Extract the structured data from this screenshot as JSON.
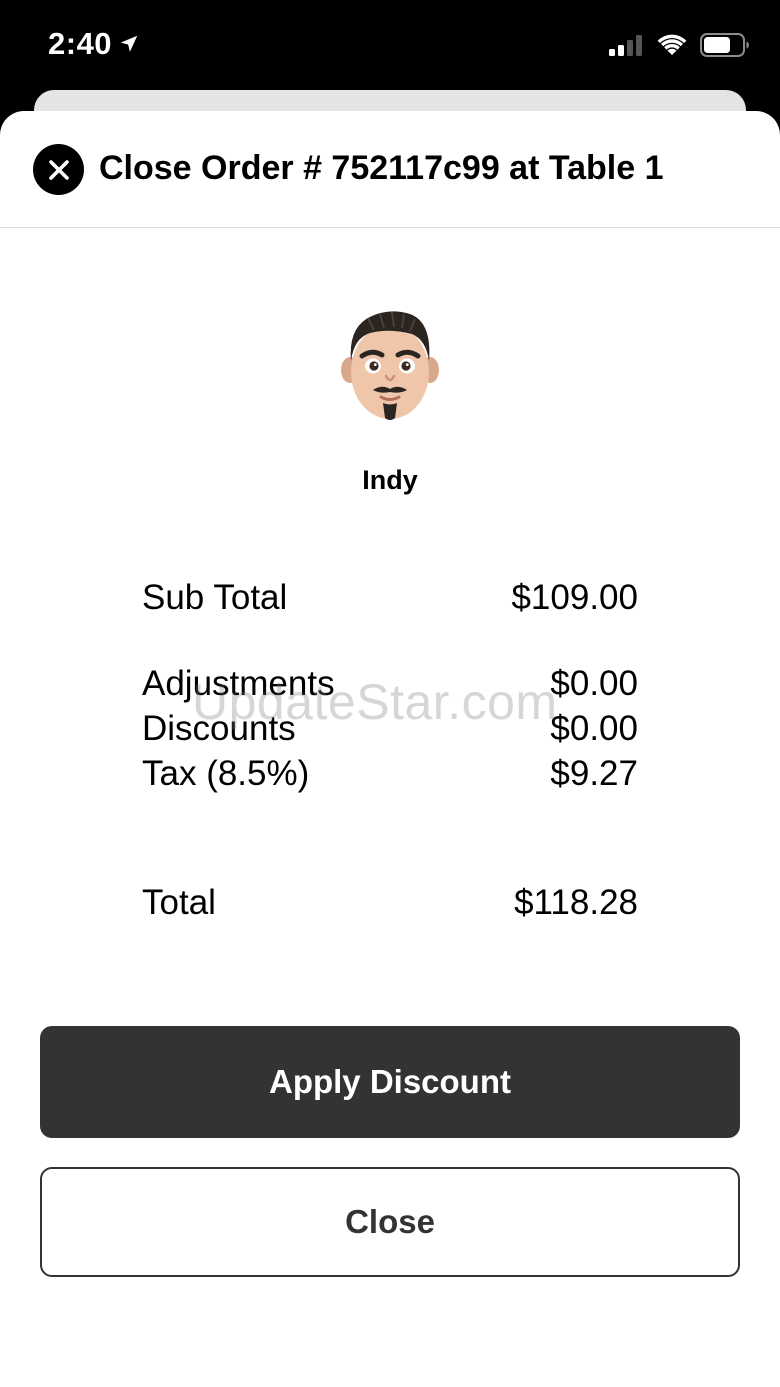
{
  "status_bar": {
    "time": "2:40",
    "location_icon": "location-arrow-icon",
    "signal_icon": "cellular-signal-icon",
    "wifi_icon": "wifi-icon",
    "battery_icon": "battery-icon"
  },
  "header": {
    "close_icon": "close-icon",
    "title": "Close Order # 752117c99 at Table 1"
  },
  "customer": {
    "avatar_icon": "memoji-avatar",
    "name": "Indy"
  },
  "summary": {
    "subtotal_label": "Sub Total",
    "subtotal_value": "$109.00",
    "adjustments_label": "Adjustments",
    "adjustments_value": "$0.00",
    "discounts_label": "Discounts",
    "discounts_value": "$0.00",
    "tax_label": "Tax (8.5%)",
    "tax_value": "$9.27",
    "total_label": "Total",
    "total_value": "$118.28"
  },
  "watermark": "UpdateStar.com",
  "actions": {
    "apply_discount_label": "Apply Discount",
    "close_label": "Close"
  },
  "colors": {
    "primary_button": "#333333",
    "background": "#ffffff",
    "status_bar": "#000000"
  }
}
